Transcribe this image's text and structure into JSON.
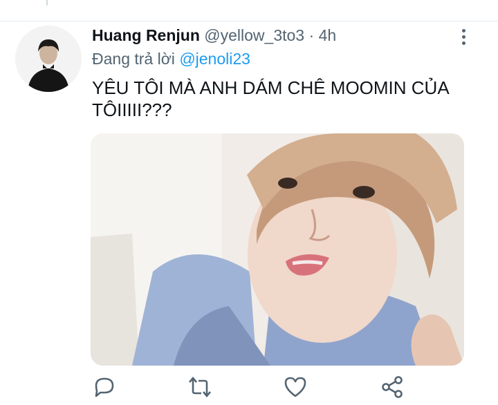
{
  "tweet": {
    "author_name": "Huang Renjun",
    "handle": "@yellow_3to3",
    "separator": "·",
    "time": "4h",
    "reply_prefix": "Đang trả lời",
    "reply_mention": "@jenoli23",
    "text": "YÊU TÔI MÀ ANH DÁM CHÊ MOOMIN CỦA TÔIIIII???"
  },
  "icons": {
    "more": "more-vertical-icon",
    "reply": "reply-icon",
    "retweet": "retweet-icon",
    "like": "heart-icon",
    "share": "share-icon"
  },
  "colors": {
    "text_primary": "#0f1419",
    "text_secondary": "#536471",
    "accent": "#1d9bf0"
  }
}
